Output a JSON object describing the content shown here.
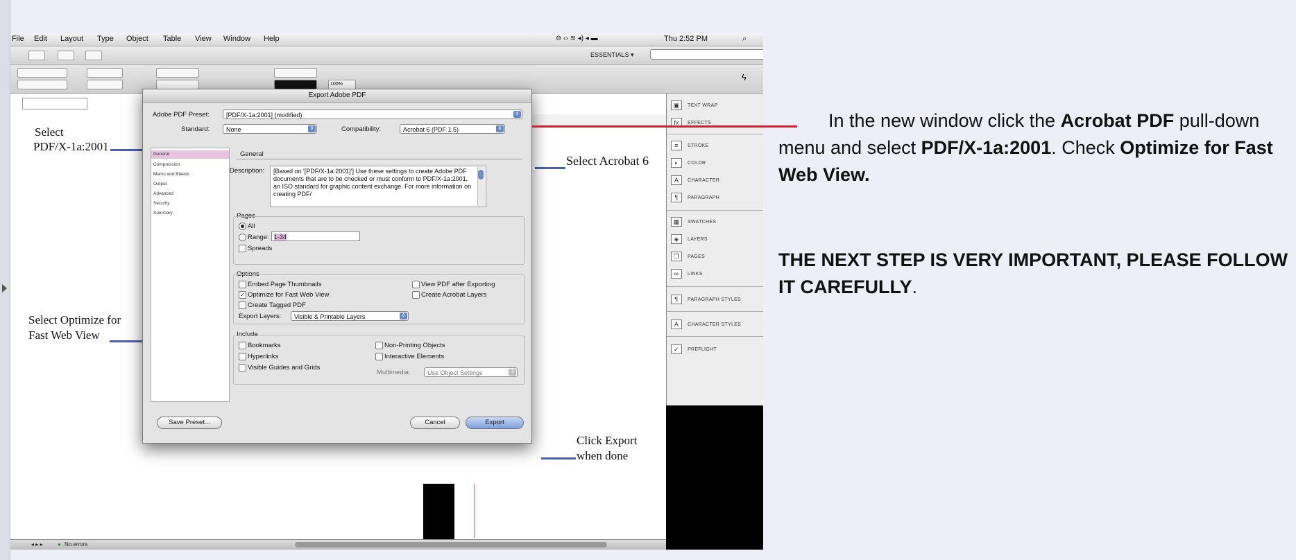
{
  "menubar": {
    "items": [
      "File",
      "Edit",
      "Layout",
      "Type",
      "Object",
      "Table",
      "View",
      "Window",
      "Help"
    ],
    "time": "Thu 2:52 PM"
  },
  "toolbar": {
    "essentials": "ESSENTIALS ▾",
    "zoom": "100%"
  },
  "panel": {
    "items": [
      "TEXT WRAP",
      "EFFECTS",
      "STROKE",
      "COLOR",
      "CHARACTER",
      "PARAGRAPH",
      "SWATCHES",
      "LAYERS",
      "PAGES",
      "LINKS",
      "PARAGRAPH STYLES",
      "CHARACTER STYLES",
      "PREFLIGHT"
    ]
  },
  "statusbar": {
    "text": "No errors"
  },
  "dialog": {
    "title": "Export Adobe PDF",
    "preset_label": "Adobe PDF Preset:",
    "preset_value": "[PDF/X-1a:2001] (modified)",
    "standard_label": "Standard:",
    "standard_value": "None",
    "compat_label": "Compatibility:",
    "compat_value": "Acrobat 6 (PDF 1.5)",
    "sidebar": [
      "General",
      "Compression",
      "Marks and Bleeds",
      "Output",
      "Advanced",
      "Security",
      "Summary"
    ],
    "section_title": "General",
    "desc_label": "Description:",
    "desc_text": "[Based on '[PDF/X-1a:2001]'] Use these settings to create Adobe PDF documents that are to be checked or must conform to PDF/X-1a:2001, an ISO standard for graphic content exchange.  For more information on creating PDF/",
    "pages_legend": "Pages",
    "pages_all": "All",
    "pages_range": "Range:",
    "range_value": "1-34",
    "pages_spreads": "Spreads",
    "options_legend": "Options",
    "opt_thumbs": "Embed Page Thumbnails",
    "opt_fastweb": "Optimize for Fast Web View",
    "opt_tagged": "Create Tagged PDF",
    "opt_viewpdf": "View PDF after Exporting",
    "opt_layers": "Create Acrobat Layers",
    "export_layers_label": "Export Layers:",
    "export_layers_value": "Visible & Printable Layers",
    "include_legend": "Include",
    "inc_bookmarks": "Bookmarks",
    "inc_hyperlinks": "Hyperlinks",
    "inc_guides": "Visible Guides and Grids",
    "inc_nonprint": "Non-Printing Objects",
    "inc_interactive": "Interactive Elements",
    "multimedia_label": "Multimedia:",
    "multimedia_value": "Use Object Settings",
    "save_preset": "Save Preset...",
    "cancel": "Cancel",
    "export": "Export"
  },
  "annotations": {
    "select_preset_1": "Select",
    "select_preset_2": "PDF/X-1a:2001",
    "select_optimize_1": "Select Optimize for",
    "select_optimize_2": "Fast Web View",
    "select_acrobat": "Select Acrobat 6",
    "click_export_1": "Click Export",
    "click_export_2": "when done"
  },
  "instructions": {
    "p1_a": "In the new window click the ",
    "p1_b": "Acrobat PDF",
    "p1_c": " pull-down menu and select ",
    "p1_d": "PDF/X-1a:2001",
    "p1_e": ". Check ",
    "p1_f": "Optimize for Fast Web View.",
    "p2_a": "THE NEXT STEP IS VERY IMPORTANT, PLEASE FOLLOW IT CAREFULLY",
    "p2_b": "."
  }
}
